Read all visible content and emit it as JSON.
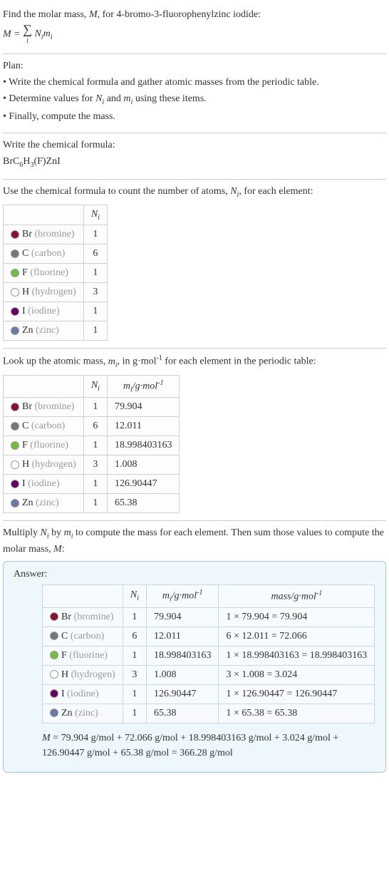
{
  "intro": {
    "line1_prefix": "Find the molar mass, ",
    "line1_M": "M",
    "line1_mid": ", for 4-bromo-3-fluorophenylzinc iodide:",
    "eq_lhs": "M = ",
    "eq_sum": "∑",
    "eq_sub": "i",
    "eq_rhs": " N",
    "eq_rhs2": "m"
  },
  "plan": {
    "title": "Plan:",
    "b1": "• Write the chemical formula and gather atomic masses from the periodic table.",
    "b2_a": "• Determine values for ",
    "b2_b": " and ",
    "b2_c": " using these items.",
    "b3": "• Finally, compute the mass."
  },
  "chemformula": {
    "title": "Write the chemical formula:",
    "value_pre": "BrC",
    "value_6": "6",
    "value_h": "H",
    "value_3": "3",
    "value_tail": "(F)ZnI"
  },
  "count": {
    "intro_a": "Use the chemical formula to count the number of atoms, ",
    "intro_b": ", for each element:"
  },
  "headers": {
    "Ni": "N",
    "Ni_sub": "i",
    "mi": "m",
    "mi_sub": "i",
    "mi_unit": "/g·mol",
    "mi_unit_sup": "-1",
    "mass": "mass/g·mol",
    "mass_sup": "-1"
  },
  "elements": [
    {
      "sym": "Br",
      "name": "(bromine)",
      "color": "#8a0f2a",
      "N": "1",
      "m": "79.904",
      "mass": "1 × 79.904 = 79.904"
    },
    {
      "sym": "C",
      "name": "(carbon)",
      "color": "#777777",
      "N": "6",
      "m": "12.011",
      "mass": "6 × 12.011 = 72.066"
    },
    {
      "sym": "F",
      "name": "(fluorine)",
      "color": "#6fbf3f",
      "N": "1",
      "m": "18.998403163",
      "mass": "1 × 18.998403163 = 18.998403163"
    },
    {
      "sym": "H",
      "name": "(hydrogen)",
      "color": "#ffffff",
      "N": "3",
      "m": "1.008",
      "mass": "3 × 1.008 = 3.024"
    },
    {
      "sym": "I",
      "name": "(iodine)",
      "color": "#660066",
      "N": "1",
      "m": "126.90447",
      "mass": "1 × 126.90447 = 126.90447"
    },
    {
      "sym": "Zn",
      "name": "(zinc)",
      "color": "#6a7aa8",
      "N": "1",
      "m": "65.38",
      "mass": "1 × 65.38 = 65.38"
    }
  ],
  "lookup": {
    "intro_a": "Look up the atomic mass, ",
    "intro_b": ", in g·mol",
    "intro_c": " for each element in the periodic table:"
  },
  "multiply": {
    "a": "Multiply ",
    "b": " by ",
    "c": " to compute the mass for each element. Then sum those values to compute the molar mass, ",
    "d": ":"
  },
  "answer": {
    "title": "Answer:",
    "final_a": "M",
    "final_b": " = 79.904 g/mol + 72.066 g/mol + 18.998403163 g/mol + 3.024 g/mol + 126.90447 g/mol + 65.38 g/mol = 366.28 g/mol"
  }
}
